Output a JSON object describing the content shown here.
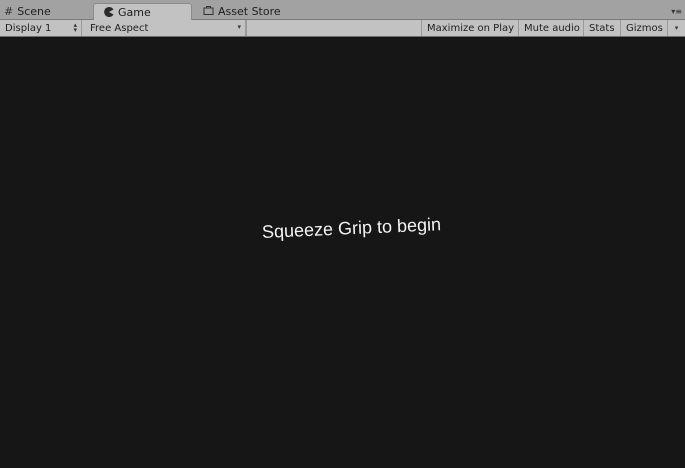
{
  "tabs": [
    {
      "label": "Scene",
      "icon": "grid-icon",
      "active": false
    },
    {
      "label": "Game",
      "icon": "pacman-icon",
      "active": true
    },
    {
      "label": "Asset Store",
      "icon": "shopping-bag-icon",
      "active": false
    }
  ],
  "tab_menu_icon": "tab-menu-icon",
  "toolbar": {
    "display": "Display 1",
    "aspect": "Free Aspect",
    "maximize_on_play": "Maximize on Play",
    "mute_audio": "Mute audio",
    "stats": "Stats",
    "gizmos": "Gizmos"
  },
  "game_view": {
    "message": "Squeeze Grip to begin",
    "background_color": "#161616"
  }
}
